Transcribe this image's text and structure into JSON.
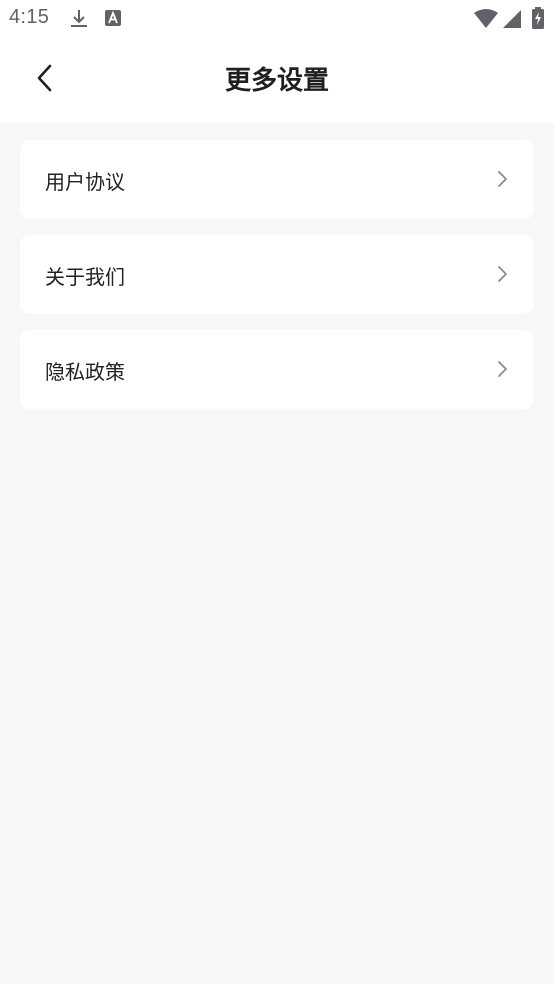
{
  "status_bar": {
    "time": "4:15",
    "left_icons": [
      "download-icon",
      "text-a-icon"
    ],
    "right_icons": [
      "wifi-icon",
      "signal-icon",
      "battery-charging-icon"
    ]
  },
  "header": {
    "title": "更多设置",
    "back_icon": "chevron-left-icon"
  },
  "menu": {
    "items": [
      {
        "label": "用户协议",
        "icon": "chevron-right-icon"
      },
      {
        "label": "关于我们",
        "icon": "chevron-right-icon"
      },
      {
        "label": "隐私政策",
        "icon": "chevron-right-icon"
      }
    ]
  },
  "colors": {
    "background": "#f6f7f9",
    "card": "#ffffff",
    "title_text": "#1f1f1f",
    "label_text": "#222222",
    "chevron": "#8a8a8a",
    "status_icons": "#5f6368"
  }
}
